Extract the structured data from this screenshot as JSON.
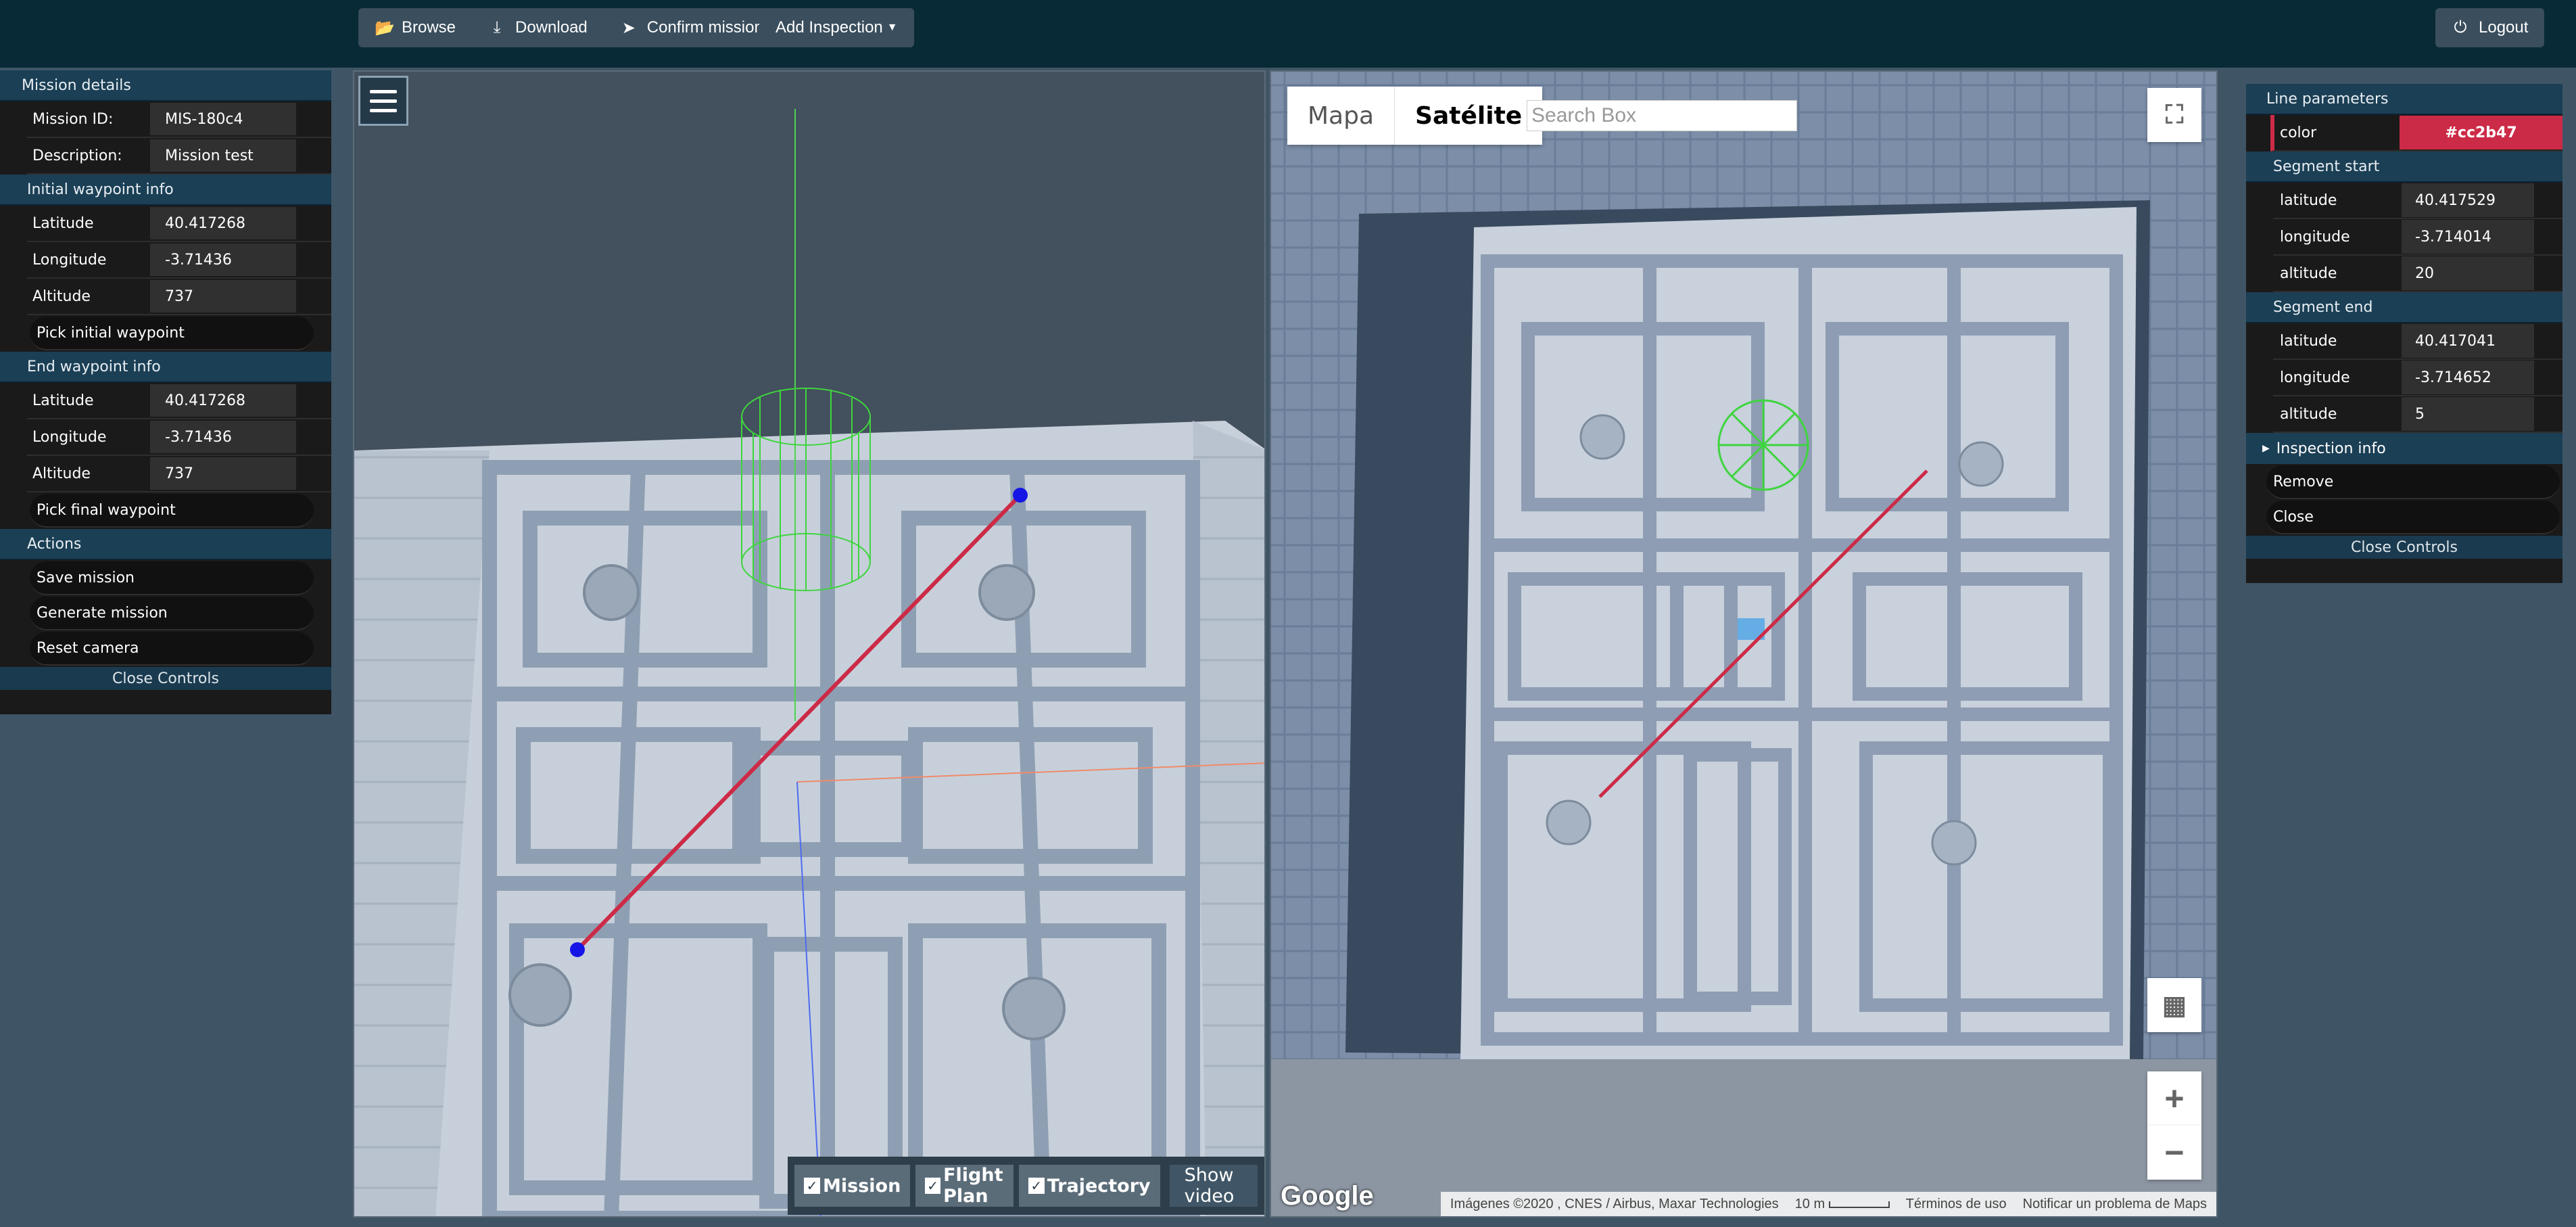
{
  "toolbar": {
    "browse": "Browse",
    "download": "Download",
    "confirm": "Confirm mission",
    "add_inspection": "Add Inspection",
    "logout": "Logout"
  },
  "left_panel": {
    "mission_details": "Mission details",
    "mission_id_label": "Mission ID:",
    "mission_id": "MIS-180c4",
    "description_label": "Description:",
    "description": "Mission test",
    "initial_wp_title": "Initial waypoint info",
    "initial": {
      "lat_label": "Latitude",
      "lat": "40.417268",
      "lon_label": "Longitude",
      "lon": "-3.71436",
      "alt_label": "Altitude",
      "alt": "737"
    },
    "pick_initial": "Pick initial waypoint",
    "end_wp_title": "End waypoint info",
    "end": {
      "lat_label": "Latitude",
      "lat": "40.417268",
      "lon_label": "Longitude",
      "lon": "-3.71436",
      "alt_label": "Altitude",
      "alt": "737"
    },
    "pick_final": "Pick final waypoint",
    "actions_title": "Actions",
    "save": "Save mission",
    "generate": "Generate mission",
    "reset": "Reset camera",
    "close": "Close Controls"
  },
  "viewer": {
    "mission": "Mission",
    "flight_plan": "Flight Plan",
    "trajectory": "Trajectory",
    "show_video": "Show video"
  },
  "map": {
    "tab_map": "Mapa",
    "tab_sat": "Satélite",
    "search_placeholder": "Search Box",
    "google": "Google",
    "attribution": "Imágenes ©2020 , CNES / Airbus, Maxar Technologies",
    "scale": "10 m",
    "terms": "Términos de uso",
    "report": "Notificar un problema de Maps"
  },
  "right_panel": {
    "line_params": "Line parameters",
    "color_label": "color",
    "color": "#cc2b47",
    "segment_start": "Segment start",
    "start": {
      "lat_label": "latitude",
      "lat": "40.417529",
      "lon_label": "longitude",
      "lon": "-3.714014",
      "alt_label": "altitude",
      "alt": "20"
    },
    "segment_end": "Segment end",
    "end": {
      "lat_label": "latitude",
      "lat": "40.417041",
      "lon_label": "longitude",
      "lon": "-3.714652",
      "alt_label": "altitude",
      "alt": "5"
    },
    "inspection_info": "Inspection info",
    "remove": "Remove",
    "close": "Close",
    "close_controls": "Close Controls"
  },
  "colors": {
    "accent": "#cc2b47",
    "topbar": "#082a36",
    "panel_header": "#1b3f55"
  }
}
